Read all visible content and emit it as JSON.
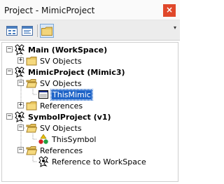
{
  "window": {
    "title": "Project - MimicProject",
    "close_glyph": "×"
  },
  "toolbar": {
    "buttons": [
      {
        "icon": "view-object-icon"
      },
      {
        "icon": "view-code-icon"
      },
      {
        "icon": "toggle-folders-icon",
        "active": true
      }
    ],
    "menu_glyph": "▾"
  },
  "tree": {
    "workspace": {
      "label": "Main (WorkSpace)",
      "expander": "−",
      "children": [
        {
          "label": "SV Objects",
          "expander": "+"
        }
      ]
    },
    "mimic_project": {
      "label": "MimicProject (Mimic3)",
      "expander": "−",
      "children": [
        {
          "label": "SV Objects",
          "expander": "−",
          "children": [
            {
              "label": "ThisMimic",
              "selected": true
            }
          ]
        },
        {
          "label": "References",
          "expander": "+"
        }
      ]
    },
    "symbol_project": {
      "label": "SymbolProject (v1)",
      "expander": "−",
      "children": [
        {
          "label": "SV Objects",
          "expander": "−",
          "children": [
            {
              "label": "ThisSymbol"
            }
          ]
        },
        {
          "label": "References",
          "expander": "−",
          "children": [
            {
              "label": "Reference to WorkSpace"
            }
          ]
        }
      ]
    }
  },
  "colors": {
    "selection": "#1e64c8",
    "close": "#e0482b",
    "folder": "#e8c560"
  }
}
